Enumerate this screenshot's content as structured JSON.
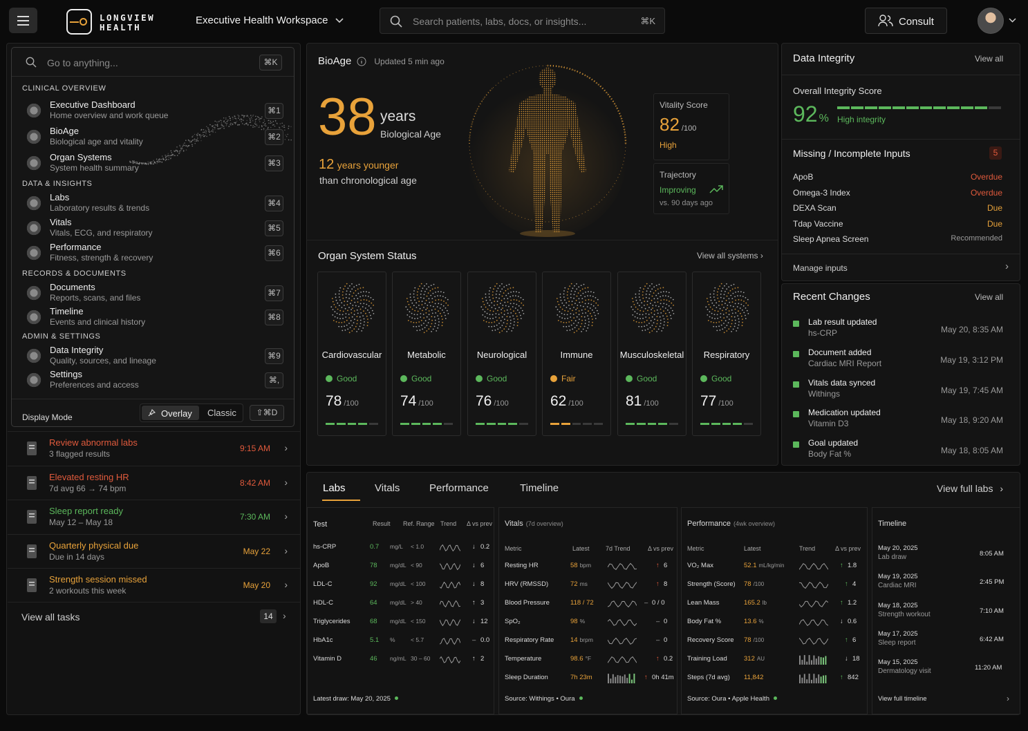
{
  "header": {
    "logo_line1": "LONGVIEW",
    "logo_line2": "HEALTH",
    "workspace": "Executive Health Workspace",
    "search_placeholder": "Search patients, labs, docs, or insights...",
    "search_shortcut": "⌘K",
    "consult_label": "Consult"
  },
  "menu": {
    "search_placeholder": "Go to anything...",
    "search_shortcut": "⌘K",
    "sections": [
      {
        "title": "CLINICAL OVERVIEW",
        "items": [
          {
            "label": "Executive Dashboard",
            "sub": "Home overview and work queue",
            "key": "⌘1"
          },
          {
            "label": "BioAge",
            "sub": "Biological age and vitality",
            "key": "⌘2"
          },
          {
            "label": "Organ Systems",
            "sub": "System health summary",
            "key": "⌘3"
          }
        ]
      },
      {
        "title": "DATA & INSIGHTS",
        "items": [
          {
            "label": "Labs",
            "sub": "Laboratory results & trends",
            "key": "⌘4"
          },
          {
            "label": "Vitals",
            "sub": "Vitals, ECG, and respiratory",
            "key": "⌘5"
          },
          {
            "label": "Performance",
            "sub": "Fitness, strength & recovery",
            "key": "⌘6"
          }
        ]
      },
      {
        "title": "RECORDS & DOCUMENTS",
        "items": [
          {
            "label": "Documents",
            "sub": "Reports, scans, and files",
            "key": "⌘7"
          },
          {
            "label": "Timeline",
            "sub": "Events and clinical history",
            "key": "⌘8"
          }
        ]
      },
      {
        "title": "ADMIN & SETTINGS",
        "items": [
          {
            "label": "Data Integrity",
            "sub": "Quality, sources, and lineage",
            "key": "⌘9"
          },
          {
            "label": "Settings",
            "sub": "Preferences and access",
            "key": "⌘,"
          }
        ]
      }
    ],
    "display_mode_label": "Display Mode",
    "mode_overlay": "Overlay",
    "mode_classic": "Classic",
    "mode_shortcut": "⇧⌘D"
  },
  "tasks": [
    {
      "title": "Review abnormal labs",
      "sub": "3 flagged results",
      "time": "9:15 AM",
      "color": "#e05a3c"
    },
    {
      "title": "Elevated resting HR",
      "sub": "7d avg 66 → 74 bpm",
      "time": "8:42 AM",
      "color": "#e05a3c"
    },
    {
      "title": "Sleep report ready",
      "sub": "May 12 – May 18",
      "time": "7:30 AM",
      "color": "#5cb85c"
    },
    {
      "title": "Quarterly physical due",
      "sub": "Due in 14 days",
      "time": "May 22",
      "color": "#e8a23a"
    },
    {
      "title": "Strength session missed",
      "sub": "2 workouts this week",
      "time": "May 20",
      "color": "#e8a23a"
    }
  ],
  "tasks_footer": {
    "label": "View all tasks",
    "count": "14"
  },
  "bioage": {
    "title": "BioAge",
    "updated": "Updated 5 min ago",
    "age": "38",
    "age_unit": "years",
    "age_label": "Biological Age",
    "younger_num": "12",
    "younger_text": "years younger",
    "younger_sub": "than chronological age",
    "vitality_label": "Vitality Score",
    "vitality_value": "82",
    "vitality_max": "/100",
    "vitality_status": "High",
    "trajectory_label": "Trajectory",
    "trajectory_value": "Improving",
    "trajectory_sub": "vs. 90 days ago"
  },
  "organs": {
    "title": "Organ System Status",
    "view_all": "View all systems",
    "items": [
      {
        "name": "Cardiovascular",
        "status": "Good",
        "score": "78",
        "max": "/100",
        "color": "#5cb85c",
        "fill": 4
      },
      {
        "name": "Metabolic",
        "status": "Good",
        "score": "74",
        "max": "/100",
        "color": "#5cb85c",
        "fill": 4
      },
      {
        "name": "Neurological",
        "status": "Good",
        "score": "76",
        "max": "/100",
        "color": "#5cb85c",
        "fill": 4
      },
      {
        "name": "Immune",
        "status": "Fair",
        "score": "62",
        "max": "/100",
        "color": "#e8a23a",
        "fill": 2
      },
      {
        "name": "Musculoskeletal",
        "status": "Good",
        "score": "81",
        "max": "/100",
        "color": "#5cb85c",
        "fill": 4
      },
      {
        "name": "Respiratory",
        "status": "Good",
        "score": "77",
        "max": "/100",
        "color": "#5cb85c",
        "fill": 4
      }
    ]
  },
  "integrity": {
    "title": "Data Integrity",
    "view_all": "View all",
    "overall_label": "Overall Integrity Score",
    "score": "92",
    "unit": "%",
    "score_fraction": 0.92,
    "status": "High integrity",
    "missing_title": "Missing / Incomplete Inputs",
    "missing_count": "5",
    "missing": [
      {
        "name": "ApoB",
        "status": "Overdue",
        "color": "#e05a3c"
      },
      {
        "name": "Omega-3 Index",
        "status": "Overdue",
        "color": "#e05a3c"
      },
      {
        "name": "DEXA Scan",
        "status": "Due",
        "color": "#e8a23a"
      },
      {
        "name": "Tdap Vaccine",
        "status": "Due",
        "color": "#e8a23a"
      },
      {
        "name": "Sleep Apnea Screen",
        "status": "Recommended",
        "color": "#9a9a9a"
      }
    ],
    "manage": "Manage inputs"
  },
  "changes": {
    "title": "Recent Changes",
    "view_all": "View all",
    "items": [
      {
        "title": "Lab result updated",
        "sub": "hs-CRP",
        "date": "May 20, 8:35 AM"
      },
      {
        "title": "Document added",
        "sub": "Cardiac MRI Report",
        "date": "May 19, 3:12 PM"
      },
      {
        "title": "Vitals data synced",
        "sub": "Withings",
        "date": "May 19, 7:45 AM"
      },
      {
        "title": "Medication updated",
        "sub": "Vitamin D3",
        "date": "May 18, 9:20 AM"
      },
      {
        "title": "Goal updated",
        "sub": "Body Fat %",
        "date": "May 18, 8:05 AM"
      }
    ]
  },
  "tabs": {
    "items": [
      "Labs",
      "Vitals",
      "Performance",
      "Timeline"
    ],
    "active": "Labs",
    "view_full": "View full labs"
  },
  "labs": {
    "title": "Test",
    "cols": [
      "Result",
      "Ref. Range",
      "Trend",
      "Δ vs prev"
    ],
    "rows": [
      {
        "test": "hs-CRP",
        "value": "0.7",
        "unit": "mg/L",
        "range": "< 1.0",
        "dir": "↓",
        "delta": "0.2"
      },
      {
        "test": "ApoB",
        "value": "78",
        "unit": "mg/dL",
        "range": "< 90",
        "dir": "↓",
        "delta": "6"
      },
      {
        "test": "LDL-C",
        "value": "92",
        "unit": "mg/dL",
        "range": "< 100",
        "dir": "↓",
        "delta": "8"
      },
      {
        "test": "HDL-C",
        "value": "64",
        "unit": "mg/dL",
        "range": "> 40",
        "dir": "↑",
        "delta": "3"
      },
      {
        "test": "Triglycerides",
        "value": "68",
        "unit": "mg/dL",
        "range": "< 150",
        "dir": "↓",
        "delta": "12"
      },
      {
        "test": "HbA1c",
        "value": "5.1",
        "unit": "%",
        "range": "< 5.7",
        "dir": "–",
        "delta": "0.0"
      },
      {
        "test": "Vitamin D",
        "value": "46",
        "unit": "ng/mL",
        "range": "30 – 60",
        "dir": "↑",
        "delta": "2"
      }
    ],
    "footer": "Latest draw: May 20, 2025"
  },
  "vitals": {
    "title": "Vitals",
    "subtitle": "(7d overview)",
    "cols": [
      "Metric",
      "Latest",
      "7d Trend",
      "Δ vs prev"
    ],
    "rows": [
      {
        "metric": "Resting HR",
        "value": "58",
        "unit": "bpm",
        "dir": "↑",
        "delta": "6"
      },
      {
        "metric": "HRV (RMSSD)",
        "value": "72",
        "unit": "ms",
        "dir": "↑",
        "delta": "8"
      },
      {
        "metric": "Blood Pressure",
        "value": "118 / 72",
        "unit": "",
        "dir": "–",
        "delta": "0 / 0"
      },
      {
        "metric": "SpO₂",
        "value": "98",
        "unit": "%",
        "dir": "–",
        "delta": "0"
      },
      {
        "metric": "Respiratory Rate",
        "value": "14",
        "unit": "brpm",
        "dir": "–",
        "delta": "0"
      },
      {
        "metric": "Temperature",
        "value": "98.6",
        "unit": "°F",
        "dir": "↑",
        "delta": "0.2"
      },
      {
        "metric": "Sleep Duration",
        "value": "7h 23m",
        "unit": "",
        "dir": "↑",
        "delta": "0h 41m"
      }
    ],
    "footer": "Source: Withings • Oura"
  },
  "performance": {
    "title": "Performance",
    "subtitle": "(4wk overview)",
    "cols": [
      "Metric",
      "Latest",
      "Trend",
      "Δ vs prev"
    ],
    "rows": [
      {
        "metric": "VO₂ Max",
        "value": "52.1",
        "unit": "mL/kg/min",
        "dir": "↑",
        "delta": "1.8"
      },
      {
        "metric": "Strength (Score)",
        "value": "78",
        "unit": "/100",
        "dir": "↑",
        "delta": "4"
      },
      {
        "metric": "Lean Mass",
        "value": "165.2",
        "unit": "lb",
        "dir": "↑",
        "delta": "1.2"
      },
      {
        "metric": "Body Fat %",
        "value": "13.6",
        "unit": "%",
        "dir": "↓",
        "delta": "0.6"
      },
      {
        "metric": "Recovery Score",
        "value": "78",
        "unit": "/100",
        "dir": "↑",
        "delta": "6"
      },
      {
        "metric": "Training Load",
        "value": "312",
        "unit": "AU",
        "dir": "↓",
        "delta": "18"
      },
      {
        "metric": "Steps (7d avg)",
        "value": "11,842",
        "unit": "",
        "dir": "↑",
        "delta": "842"
      }
    ],
    "footer": "Source: Oura • Apple Health"
  },
  "timeline": {
    "title": "Timeline",
    "items": [
      {
        "date": "May 20, 2025",
        "event": "Lab draw",
        "time": "8:05 AM"
      },
      {
        "date": "May 19, 2025",
        "event": "Cardiac MRI",
        "time": "2:45 PM"
      },
      {
        "date": "May 18, 2025",
        "event": "Strength workout",
        "time": "7:10 AM"
      },
      {
        "date": "May 17, 2025",
        "event": "Sleep report",
        "time": "6:42 AM"
      },
      {
        "date": "May 15, 2025",
        "event": "Dermatology visit",
        "time": "11:20 AM"
      }
    ],
    "footer": "View full timeline"
  },
  "colors": {
    "accent": "#e8a23a",
    "good": "#5cb85c",
    "alert": "#e05a3c",
    "bg": "#0b0b0b",
    "panel": "#141414"
  }
}
